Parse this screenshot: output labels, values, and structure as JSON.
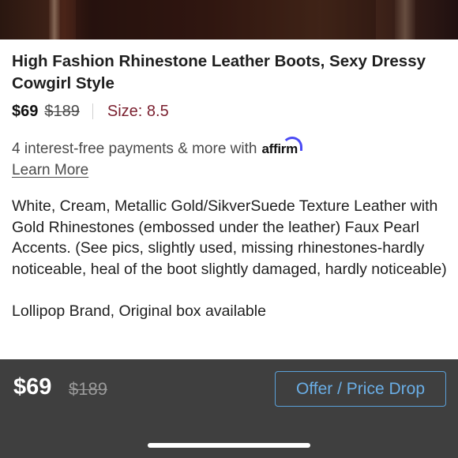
{
  "listing": {
    "title": "High Fashion Rhinestone Leather Boots, Sexy Dressy Cowgirl Style",
    "price": "$69",
    "original_price": "$189",
    "size_label": "Size: 8.5",
    "description": "White, Cream, Metallic Gold/SikverSuede Texture Leather with Gold Rhinestones (embossed under the leather) Faux Pearl Accents.  (See pics, slightly used, missing rhinestones-hardly noticeable, heal of the boot slightly damaged, hardly noticeable)\n\nLollipop Brand, Original box available"
  },
  "affirm": {
    "text": "4 interest-free payments & more with",
    "logo_text": "affirm",
    "learn_more": "Learn More"
  },
  "bottom_bar": {
    "price": "$69",
    "original_price": "$189",
    "offer_button": "Offer / Price Drop"
  },
  "colors": {
    "size": "#7a1f2e",
    "bottom_bar_bg": "#3f3f3f",
    "offer_button": "#6aaee6",
    "affirm_arc": "#4a4af4"
  }
}
